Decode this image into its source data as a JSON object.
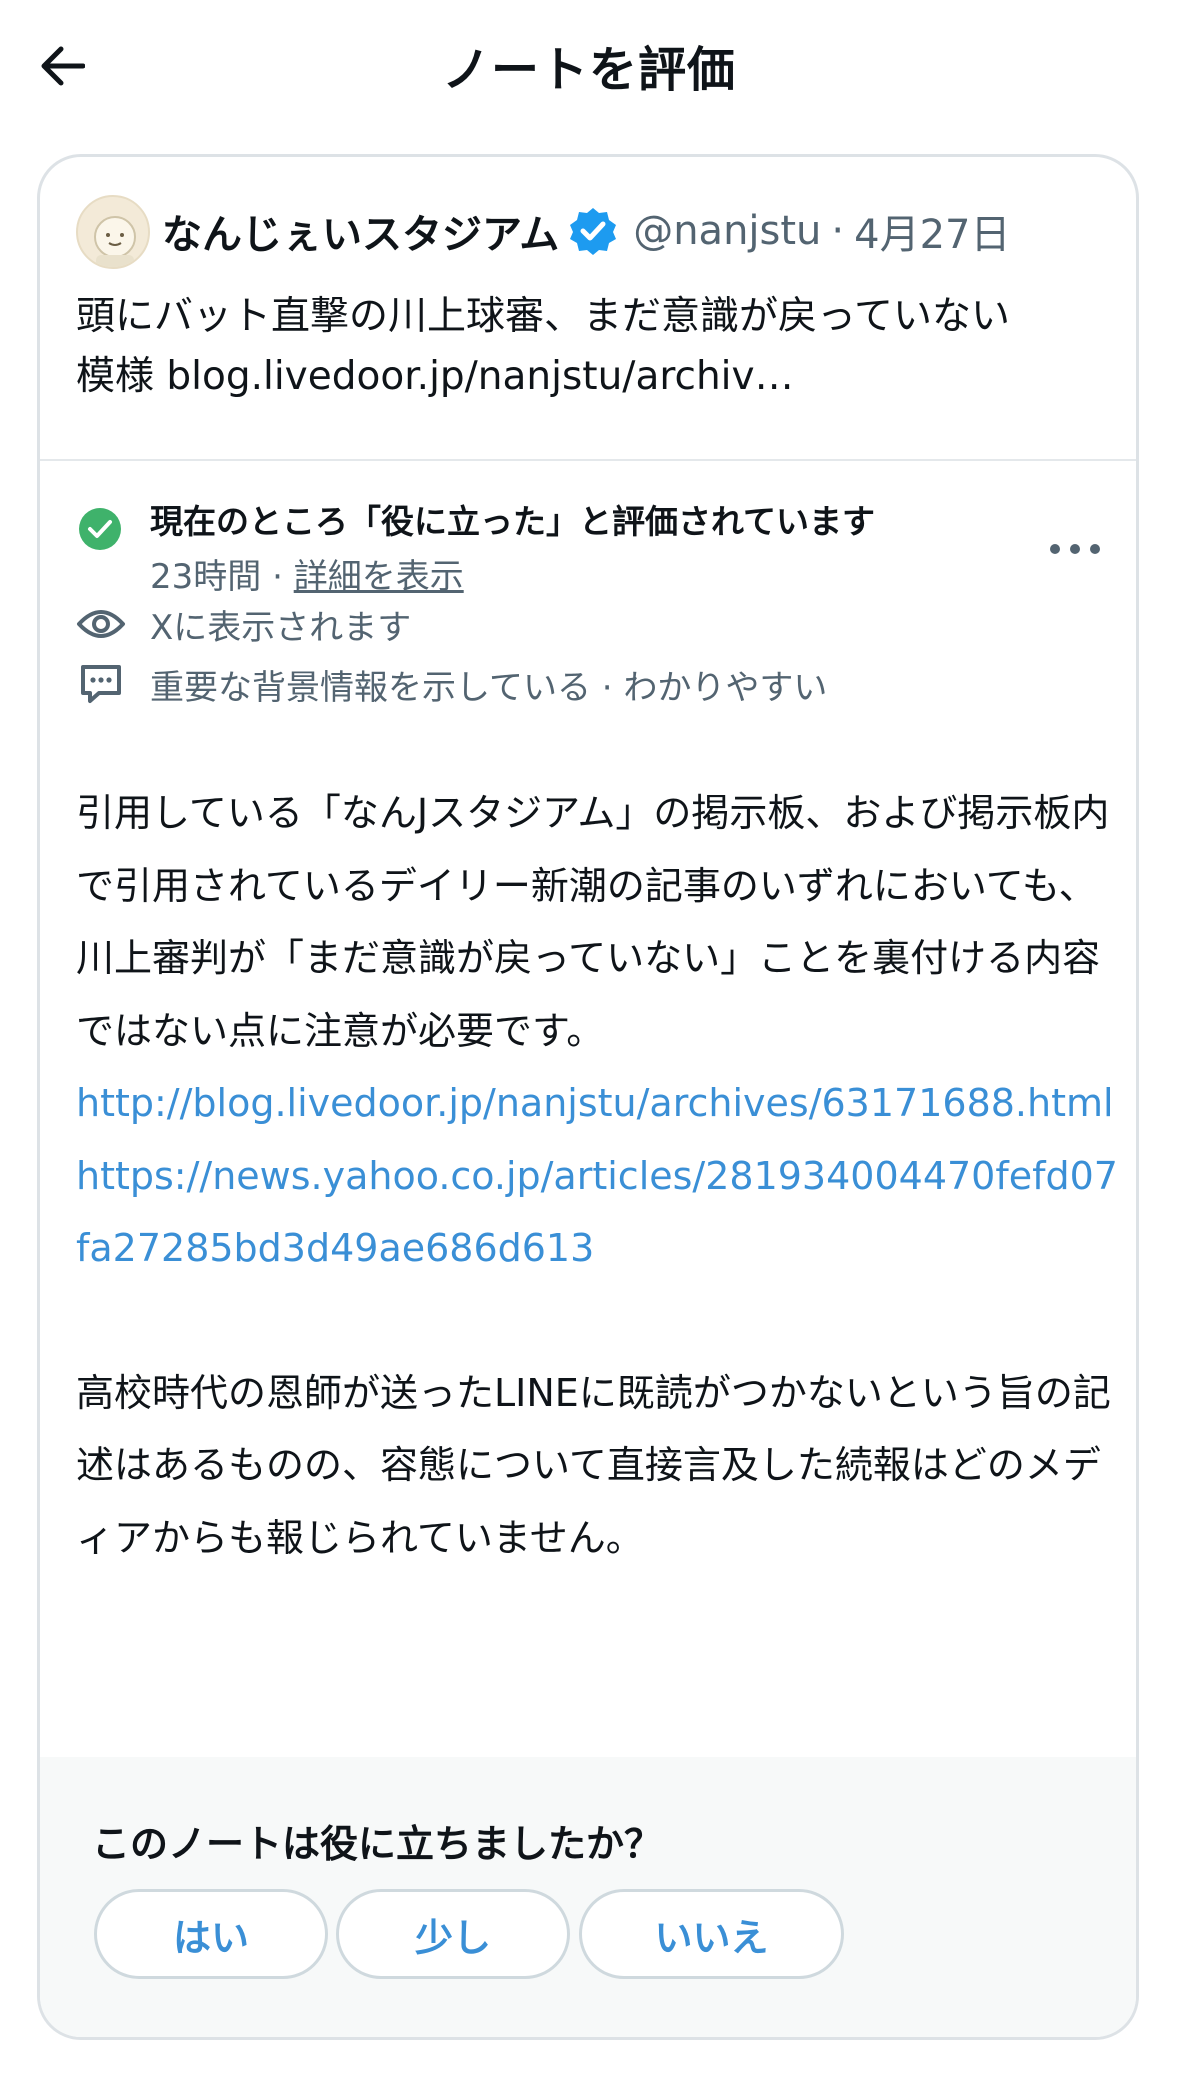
{
  "header": {
    "title": "ノートを評価",
    "back_icon": "arrow-left-icon"
  },
  "tweet": {
    "display_name": "なんじぇいスタジアム",
    "verified_icon": "verified-badge-icon",
    "handle": "@nanjstu",
    "separator": "·",
    "date": "4月27日",
    "text_line1": "頭にバット直撃の川上球審、まだ意識が戻っていない",
    "text_line2": "模様 blog.livedoor.jp/nanjstu/archiv…"
  },
  "note": {
    "status": "現在のところ「役に立った」と評価されています",
    "age": "23時間",
    "meta_sep": "·",
    "details_link": "詳細を表示",
    "visibility": "Xに表示されます",
    "tags": "重要な背景情報を示している · わかりやすい",
    "paragraph1": "引用している「なんJスタジアム」の掲示板、および掲示板内で引用されているデイリー新潮の記事のいずれにおいても、川上審判が「まだ意識が戻っていない」ことを裏付ける内容ではない点に注意が必要です。",
    "link1": "http://blog.livedoor.jp/nanjstu/archives/63171688.html",
    "link2": "https://news.yahoo.co.jp/articles/281934004470fefd07fa27285bd3d49ae686d613",
    "paragraph2": "高校時代の恩師が送ったLINEに既読がつかないという旨の記述はあるものの、容態について直接言及した続報はどのメディアからも報じられていません。"
  },
  "rating": {
    "question": "このノートは役に立ちましたか？",
    "yes": "はい",
    "somewhat": "少し",
    "no": "いいえ"
  },
  "colors": {
    "accent": "#3a8fd6",
    "success": "#3fb26b",
    "muted": "#536471",
    "verified": "#1d9bf0"
  }
}
